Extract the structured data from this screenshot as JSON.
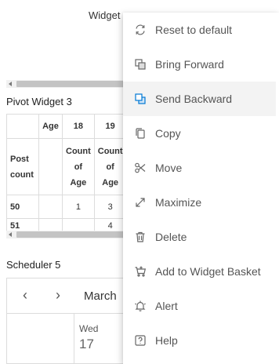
{
  "header": {
    "widget_label": "Widget"
  },
  "pivot": {
    "title": "Pivot Widget 3",
    "header_row": [
      "",
      "Age",
      "18",
      "19"
    ],
    "row_header": "Post count",
    "measure_label": "Count of Age",
    "rows": [
      {
        "label": "50",
        "values": [
          "1",
          "3"
        ]
      },
      {
        "label": "51",
        "values": [
          "",
          "4"
        ]
      }
    ]
  },
  "scheduler": {
    "title": "Scheduler 5",
    "prev_icon": "‹",
    "next_icon": "›",
    "month_label": "March",
    "day_name": "Wed",
    "day_number": "17"
  },
  "context_menu": {
    "items": [
      {
        "label": "Reset to default",
        "icon": "reset-icon"
      },
      {
        "label": "Bring Forward",
        "icon": "bring-forward-icon"
      },
      {
        "label": "Send Backward",
        "icon": "send-backward-icon",
        "active": true
      },
      {
        "label": "Copy",
        "icon": "copy-icon"
      },
      {
        "label": "Move",
        "icon": "move-icon"
      },
      {
        "label": "Maximize",
        "icon": "maximize-icon"
      },
      {
        "label": "Delete",
        "icon": "trash-icon"
      },
      {
        "label": "Add to Widget Basket",
        "icon": "basket-icon"
      },
      {
        "label": "Alert",
        "icon": "bell-icon"
      },
      {
        "label": "Help",
        "icon": "help-icon"
      }
    ],
    "accent_color": "#0078d4"
  }
}
